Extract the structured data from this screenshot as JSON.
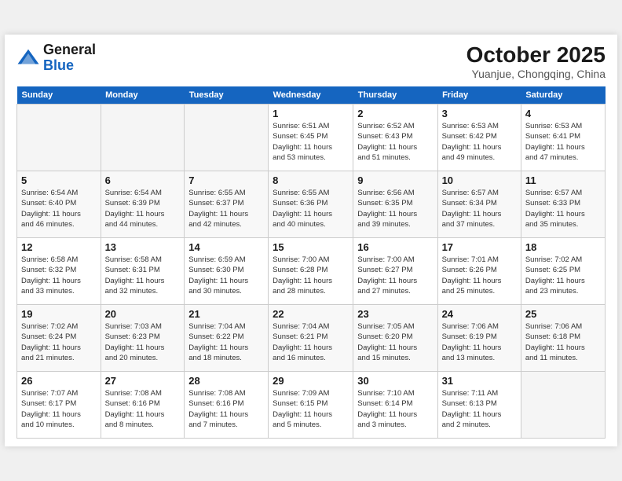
{
  "header": {
    "logo_line1": "General",
    "logo_line2": "Blue",
    "month_title": "October 2025",
    "location": "Yuanjue, Chongqing, China"
  },
  "days_of_week": [
    "Sunday",
    "Monday",
    "Tuesday",
    "Wednesday",
    "Thursday",
    "Friday",
    "Saturday"
  ],
  "weeks": [
    [
      {
        "day": "",
        "info": ""
      },
      {
        "day": "",
        "info": ""
      },
      {
        "day": "",
        "info": ""
      },
      {
        "day": "1",
        "info": "Sunrise: 6:51 AM\nSunset: 6:45 PM\nDaylight: 11 hours\nand 53 minutes."
      },
      {
        "day": "2",
        "info": "Sunrise: 6:52 AM\nSunset: 6:43 PM\nDaylight: 11 hours\nand 51 minutes."
      },
      {
        "day": "3",
        "info": "Sunrise: 6:53 AM\nSunset: 6:42 PM\nDaylight: 11 hours\nand 49 minutes."
      },
      {
        "day": "4",
        "info": "Sunrise: 6:53 AM\nSunset: 6:41 PM\nDaylight: 11 hours\nand 47 minutes."
      }
    ],
    [
      {
        "day": "5",
        "info": "Sunrise: 6:54 AM\nSunset: 6:40 PM\nDaylight: 11 hours\nand 46 minutes."
      },
      {
        "day": "6",
        "info": "Sunrise: 6:54 AM\nSunset: 6:39 PM\nDaylight: 11 hours\nand 44 minutes."
      },
      {
        "day": "7",
        "info": "Sunrise: 6:55 AM\nSunset: 6:37 PM\nDaylight: 11 hours\nand 42 minutes."
      },
      {
        "day": "8",
        "info": "Sunrise: 6:55 AM\nSunset: 6:36 PM\nDaylight: 11 hours\nand 40 minutes."
      },
      {
        "day": "9",
        "info": "Sunrise: 6:56 AM\nSunset: 6:35 PM\nDaylight: 11 hours\nand 39 minutes."
      },
      {
        "day": "10",
        "info": "Sunrise: 6:57 AM\nSunset: 6:34 PM\nDaylight: 11 hours\nand 37 minutes."
      },
      {
        "day": "11",
        "info": "Sunrise: 6:57 AM\nSunset: 6:33 PM\nDaylight: 11 hours\nand 35 minutes."
      }
    ],
    [
      {
        "day": "12",
        "info": "Sunrise: 6:58 AM\nSunset: 6:32 PM\nDaylight: 11 hours\nand 33 minutes."
      },
      {
        "day": "13",
        "info": "Sunrise: 6:58 AM\nSunset: 6:31 PM\nDaylight: 11 hours\nand 32 minutes."
      },
      {
        "day": "14",
        "info": "Sunrise: 6:59 AM\nSunset: 6:30 PM\nDaylight: 11 hours\nand 30 minutes."
      },
      {
        "day": "15",
        "info": "Sunrise: 7:00 AM\nSunset: 6:28 PM\nDaylight: 11 hours\nand 28 minutes."
      },
      {
        "day": "16",
        "info": "Sunrise: 7:00 AM\nSunset: 6:27 PM\nDaylight: 11 hours\nand 27 minutes."
      },
      {
        "day": "17",
        "info": "Sunrise: 7:01 AM\nSunset: 6:26 PM\nDaylight: 11 hours\nand 25 minutes."
      },
      {
        "day": "18",
        "info": "Sunrise: 7:02 AM\nSunset: 6:25 PM\nDaylight: 11 hours\nand 23 minutes."
      }
    ],
    [
      {
        "day": "19",
        "info": "Sunrise: 7:02 AM\nSunset: 6:24 PM\nDaylight: 11 hours\nand 21 minutes."
      },
      {
        "day": "20",
        "info": "Sunrise: 7:03 AM\nSunset: 6:23 PM\nDaylight: 11 hours\nand 20 minutes."
      },
      {
        "day": "21",
        "info": "Sunrise: 7:04 AM\nSunset: 6:22 PM\nDaylight: 11 hours\nand 18 minutes."
      },
      {
        "day": "22",
        "info": "Sunrise: 7:04 AM\nSunset: 6:21 PM\nDaylight: 11 hours\nand 16 minutes."
      },
      {
        "day": "23",
        "info": "Sunrise: 7:05 AM\nSunset: 6:20 PM\nDaylight: 11 hours\nand 15 minutes."
      },
      {
        "day": "24",
        "info": "Sunrise: 7:06 AM\nSunset: 6:19 PM\nDaylight: 11 hours\nand 13 minutes."
      },
      {
        "day": "25",
        "info": "Sunrise: 7:06 AM\nSunset: 6:18 PM\nDaylight: 11 hours\nand 11 minutes."
      }
    ],
    [
      {
        "day": "26",
        "info": "Sunrise: 7:07 AM\nSunset: 6:17 PM\nDaylight: 11 hours\nand 10 minutes."
      },
      {
        "day": "27",
        "info": "Sunrise: 7:08 AM\nSunset: 6:16 PM\nDaylight: 11 hours\nand 8 minutes."
      },
      {
        "day": "28",
        "info": "Sunrise: 7:08 AM\nSunset: 6:16 PM\nDaylight: 11 hours\nand 7 minutes."
      },
      {
        "day": "29",
        "info": "Sunrise: 7:09 AM\nSunset: 6:15 PM\nDaylight: 11 hours\nand 5 minutes."
      },
      {
        "day": "30",
        "info": "Sunrise: 7:10 AM\nSunset: 6:14 PM\nDaylight: 11 hours\nand 3 minutes."
      },
      {
        "day": "31",
        "info": "Sunrise: 7:11 AM\nSunset: 6:13 PM\nDaylight: 11 hours\nand 2 minutes."
      },
      {
        "day": "",
        "info": ""
      }
    ]
  ]
}
